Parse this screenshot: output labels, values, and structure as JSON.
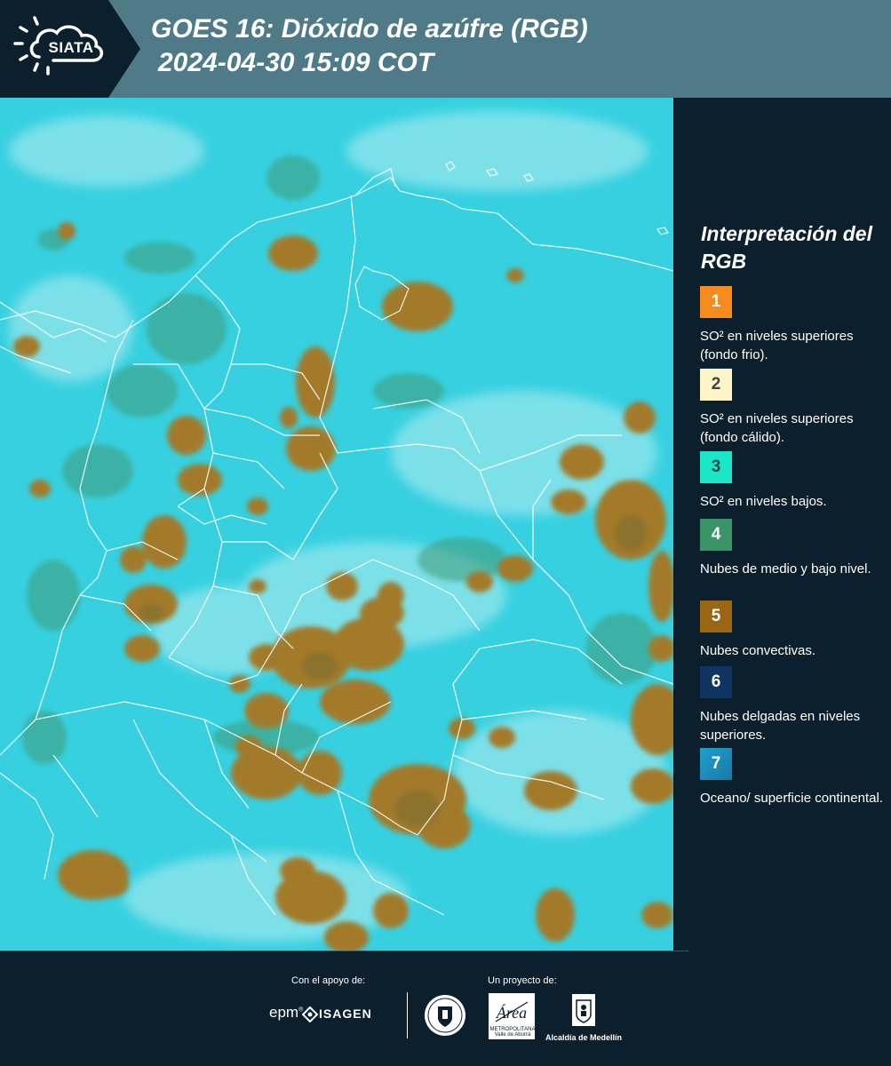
{
  "header": {
    "logo_text": "SIATA",
    "title_line1": "GOES 16: Dióxido de azúfre (RGB)",
    "title_line2": "2024-04-30 15:09 COT"
  },
  "legend": {
    "title": "Interpretación del RGB",
    "items": [
      {
        "number": "1",
        "label": "SO² en niveles superiores (fondo frio).",
        "color": "#f68b1f",
        "text_color": "#ffffff"
      },
      {
        "number": "2",
        "label": "SO² en niveles superiores (fondo cálido).",
        "color": "#fcf5c8",
        "text_color": "#444444"
      },
      {
        "number": "3",
        "label": "SO² en niveles bajos.",
        "color": "#1ce6c8",
        "text_color": "#1b4a4a"
      },
      {
        "number": "4",
        "label": "Nubes de medio y bajo nivel.",
        "color": "#3b9468",
        "text_color": "#ffffff"
      },
      {
        "number": "5",
        "label": "Nubes convectivas.",
        "color": "#9b6614",
        "text_color": "#ffffff"
      },
      {
        "number": "6",
        "label": "Nubes delgadas en niveles superiores.",
        "color": "#0f3462",
        "text_color": "#ffffff"
      },
      {
        "number": "7",
        "label": "Oceano/ superficie continental.",
        "color": "#1f8fb8",
        "text_color": "#ffffff"
      }
    ]
  },
  "map": {
    "background_color": "#36d0e0",
    "convective_cloud_color": "#a27a2c",
    "mid_low_cloud_color": "#3f9a74",
    "border_color": "#ffffff"
  },
  "footer": {
    "support_label": "Con el apoyo de:",
    "project_label": "Un proyecto de:",
    "epm": "epm",
    "isagen": "ISAGEN",
    "area_sub": "METROPOLITANA Valle de Aburrá",
    "alcaldia": "Alcaldía de Medellín"
  }
}
